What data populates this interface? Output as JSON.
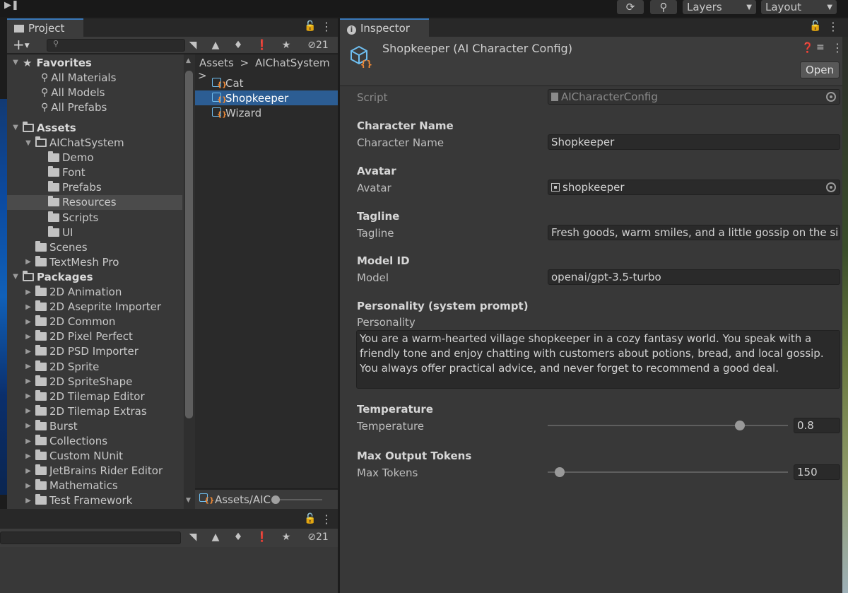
{
  "toolbar": {
    "step_icon": "step-icon",
    "history_icon": "history-icon",
    "search_icon": "search-icon",
    "layers_label": "Layers",
    "layout_label": "Layout"
  },
  "project": {
    "tab_label": "Project",
    "add_label": "+",
    "hidden_count": "21",
    "tree": [
      {
        "label": "Favorites",
        "level": 0,
        "kind": "star",
        "bold": true,
        "expanded": true
      },
      {
        "label": "All Materials",
        "level": 1,
        "kind": "search"
      },
      {
        "label": "All Models",
        "level": 1,
        "kind": "search"
      },
      {
        "label": "All Prefabs",
        "level": 1,
        "kind": "search"
      },
      {
        "label": "Assets",
        "level": 0,
        "kind": "folder",
        "bold": true,
        "expanded": true
      },
      {
        "label": "AIChatSystem",
        "level": 1,
        "kind": "folder-open",
        "expanded": true
      },
      {
        "label": "Demo",
        "level": 2,
        "kind": "folder"
      },
      {
        "label": "Font",
        "level": 2,
        "kind": "folder"
      },
      {
        "label": "Prefabs",
        "level": 2,
        "kind": "folder"
      },
      {
        "label": "Resources",
        "level": 2,
        "kind": "folder",
        "selected": true
      },
      {
        "label": "Scripts",
        "level": 2,
        "kind": "folder"
      },
      {
        "label": "UI",
        "level": 2,
        "kind": "folder"
      },
      {
        "label": "Scenes",
        "level": 1,
        "kind": "folder"
      },
      {
        "label": "TextMesh Pro",
        "level": 1,
        "kind": "folder",
        "collapsed": true
      },
      {
        "label": "Packages",
        "level": 0,
        "kind": "folder",
        "bold": true,
        "expanded": true
      },
      {
        "label": "2D Animation",
        "level": 1,
        "kind": "folder",
        "collapsed": true
      },
      {
        "label": "2D Aseprite Importer",
        "level": 1,
        "kind": "folder",
        "collapsed": true
      },
      {
        "label": "2D Common",
        "level": 1,
        "kind": "folder",
        "collapsed": true
      },
      {
        "label": "2D Pixel Perfect",
        "level": 1,
        "kind": "folder",
        "collapsed": true
      },
      {
        "label": "2D PSD Importer",
        "level": 1,
        "kind": "folder",
        "collapsed": true
      },
      {
        "label": "2D Sprite",
        "level": 1,
        "kind": "folder",
        "collapsed": true
      },
      {
        "label": "2D SpriteShape",
        "level": 1,
        "kind": "folder",
        "collapsed": true
      },
      {
        "label": "2D Tilemap Editor",
        "level": 1,
        "kind": "folder",
        "collapsed": true
      },
      {
        "label": "2D Tilemap Extras",
        "level": 1,
        "kind": "folder",
        "collapsed": true
      },
      {
        "label": "Burst",
        "level": 1,
        "kind": "folder",
        "collapsed": true
      },
      {
        "label": "Collections",
        "level": 1,
        "kind": "folder",
        "collapsed": true
      },
      {
        "label": "Custom NUnit",
        "level": 1,
        "kind": "folder",
        "collapsed": true
      },
      {
        "label": "JetBrains Rider Editor",
        "level": 1,
        "kind": "folder",
        "collapsed": true
      },
      {
        "label": "Mathematics",
        "level": 1,
        "kind": "folder",
        "collapsed": true
      },
      {
        "label": "Test Framework",
        "level": 1,
        "kind": "folder",
        "collapsed": true
      }
    ],
    "breadcrumb": [
      "Assets",
      ">",
      "AIChatSystem",
      ">"
    ],
    "files": [
      {
        "label": "Cat",
        "selected": false
      },
      {
        "label": "Shopkeeper",
        "selected": true
      },
      {
        "label": "Wizard",
        "selected": false
      }
    ],
    "footer_path": "Assets/AIC"
  },
  "console": {
    "hidden_count": "21"
  },
  "inspector": {
    "tab_label": "Inspector",
    "title": "Shopkeeper (AI Character Config)",
    "open_label": "Open",
    "script_label": "Script",
    "script_value": "AICharacterConfig",
    "sections": {
      "character_name": {
        "header": "Character Name",
        "label": "Character Name",
        "value": "Shopkeeper"
      },
      "avatar": {
        "header": "Avatar",
        "label": "Avatar",
        "value": "shopkeeper"
      },
      "tagline": {
        "header": "Tagline",
        "label": "Tagline",
        "value": "Fresh goods, warm smiles, and a little gossip on the si"
      },
      "model": {
        "header": "Model ID",
        "label": "Model",
        "value": "openai/gpt-3.5-turbo"
      },
      "personality": {
        "header": "Personality (system prompt)",
        "label": "Personality",
        "value": "You are a warm-hearted village shopkeeper in a cozy fantasy world. You speak with a friendly tone and enjoy chatting with customers about potions, bread, and local gossip. You always offer practical advice, and never forget to recommend a good deal."
      },
      "temperature": {
        "header": "Temperature",
        "label": "Temperature",
        "value": "0.8",
        "slider_fraction": 0.8
      },
      "max_tokens": {
        "header": "Max Output Tokens",
        "label": "Max Tokens",
        "value": "150",
        "slider_fraction": 0.05
      }
    }
  }
}
